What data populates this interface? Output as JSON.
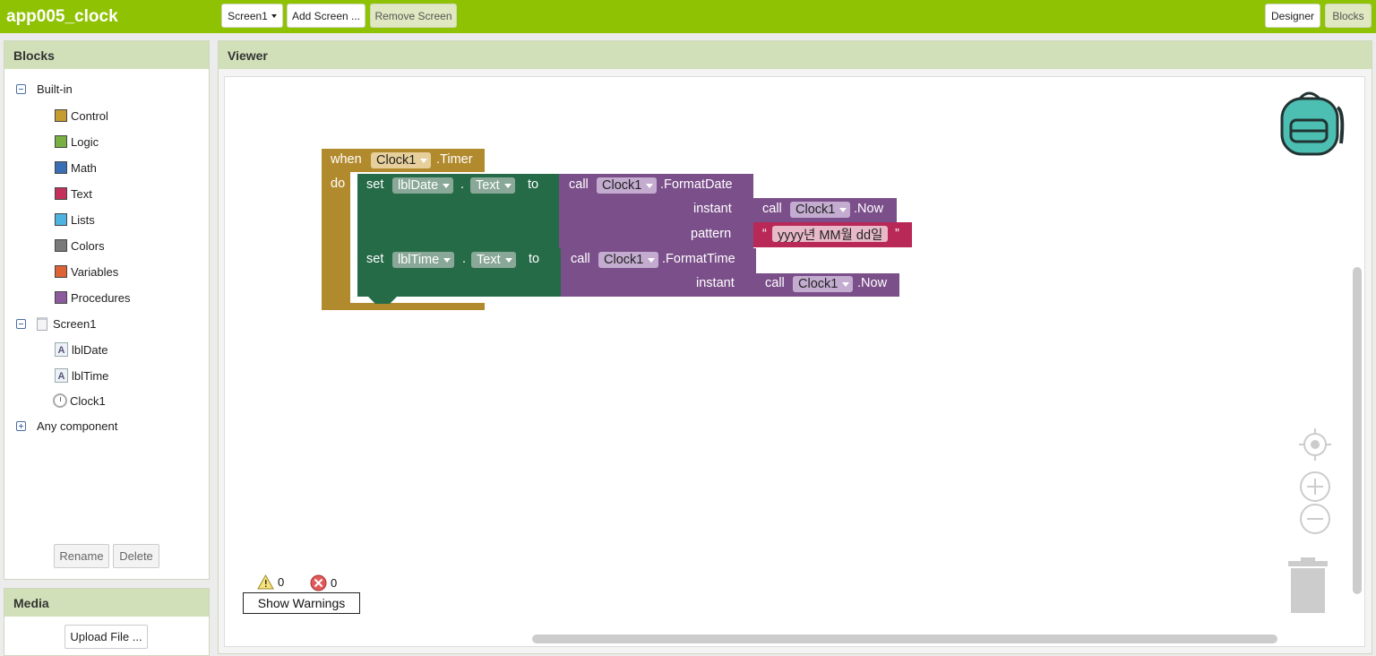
{
  "app": {
    "title": "app005_clock"
  },
  "toolbar": {
    "screen_selector": "Screen1",
    "add_screen": "Add Screen ...",
    "remove_screen": "Remove Screen",
    "designer": "Designer",
    "blocks": "Blocks"
  },
  "blocks_panel": {
    "title": "Blocks",
    "builtin_label": "Built-in",
    "builtin_items": [
      {
        "label": "Control",
        "color": "#c69b2f"
      },
      {
        "label": "Logic",
        "color": "#79b043"
      },
      {
        "label": "Math",
        "color": "#3b6fb5"
      },
      {
        "label": "Text",
        "color": "#c4325b"
      },
      {
        "label": "Lists",
        "color": "#4fb3e0"
      },
      {
        "label": "Colors",
        "color": "#7a7a7a"
      },
      {
        "label": "Variables",
        "color": "#dd6336"
      },
      {
        "label": "Procedures",
        "color": "#8c5b9e"
      }
    ],
    "screen_label": "Screen1",
    "components": [
      {
        "label": "lblDate",
        "icon": "label-icon"
      },
      {
        "label": "lblTime",
        "icon": "label-icon"
      },
      {
        "label": "Clock1",
        "icon": "clock-icon"
      }
    ],
    "any_component": "Any component",
    "rename_button": "Rename",
    "delete_button": "Delete"
  },
  "media_panel": {
    "title": "Media",
    "upload_button": "Upload File ..."
  },
  "viewer": {
    "title": "Viewer",
    "warning_count": "0",
    "error_count": "0",
    "show_warnings": "Show Warnings"
  },
  "code": {
    "event": {
      "when": "when",
      "component": "Clock1",
      "event": ".Timer",
      "do": "do"
    },
    "set1": {
      "set": "set",
      "component": "lblDate",
      "dot": ".",
      "property": "Text",
      "to": "to"
    },
    "call1": {
      "call": "call",
      "component": "Clock1",
      "method": ".FormatDate",
      "arg1": "instant",
      "arg2": "pattern"
    },
    "now1": {
      "call": "call",
      "component": "Clock1",
      "method": ".Now"
    },
    "text_literal": {
      "open_quote": "“",
      "value": "yyyy년 MM월 dd일",
      "close_quote": "”"
    },
    "set2": {
      "set": "set",
      "component": "lblTime",
      "dot": ".",
      "property": "Text",
      "to": "to"
    },
    "call2": {
      "call": "call",
      "component": "Clock1",
      "method": ".FormatTime",
      "arg1": "instant"
    },
    "now2": {
      "call": "call",
      "component": "Clock1",
      "method": ".Now"
    }
  },
  "colors": {
    "topbar": "#8fc202",
    "control_block": "#b28a2e",
    "component_set_block": "#266b48",
    "component_call_block": "#7b4f8a",
    "text_block": "#b82958"
  }
}
